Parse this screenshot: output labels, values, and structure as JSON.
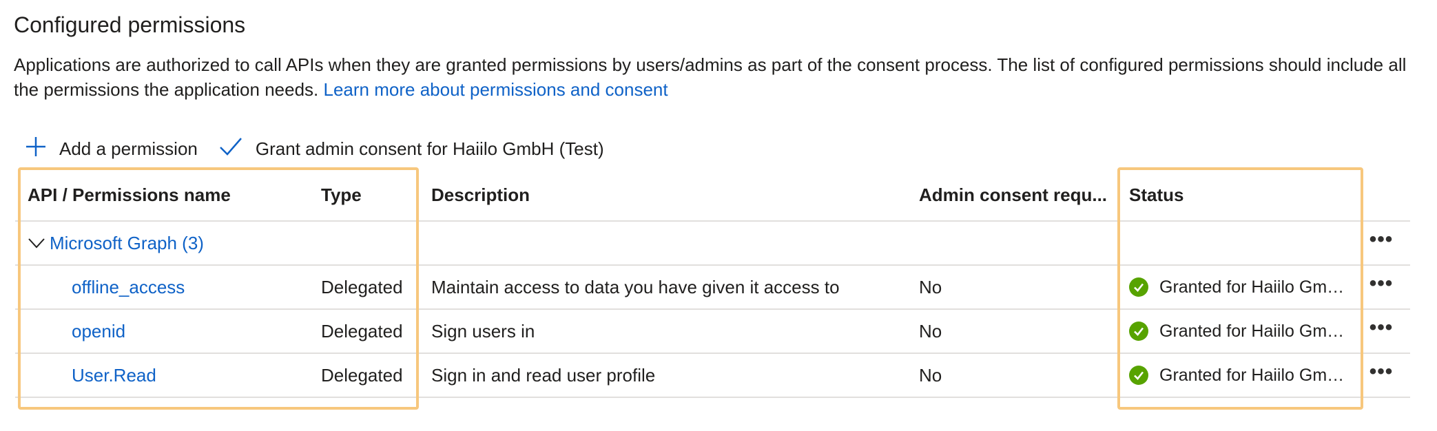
{
  "page": {
    "title": "Configured permissions",
    "intro_text": "Applications are authorized to call APIs when they are granted permissions by users/admins as part of the consent process. The list of configured permissions should include all the permissions the application needs.",
    "intro_link": "Learn more about permissions and consent"
  },
  "toolbar": {
    "add_label": "Add a permission",
    "grant_label": "Grant admin consent for Haiilo GmbH (Test)"
  },
  "table": {
    "headers": {
      "api": "API / Permissions name",
      "type": "Type",
      "description": "Description",
      "admin": "Admin consent requ...",
      "status": "Status"
    },
    "group": {
      "label": "Microsoft Graph (3)",
      "more": "•••"
    },
    "rows": [
      {
        "name": "offline_access",
        "type": "Delegated",
        "description": "Maintain access to data you have given it access to",
        "admin": "No",
        "status": "Granted for Haiilo GmbH (Test)",
        "more": "•••"
      },
      {
        "name": "openid",
        "type": "Delegated",
        "description": "Sign users in",
        "admin": "No",
        "status": "Granted for Haiilo GmbH (Test)",
        "more": "•••"
      },
      {
        "name": "User.Read",
        "type": "Delegated",
        "description": "Sign in and read user profile",
        "admin": "No",
        "status": "Granted for Haiilo GmbH (Test)",
        "more": "•••"
      }
    ]
  },
  "colors": {
    "link": "#0f62c7",
    "status_success": "#57a300",
    "highlight": "#f7c77d",
    "divider": "#e1dfdd"
  },
  "icons": {
    "add": "plus-icon",
    "grant": "checkmark-icon",
    "expand": "chevron-down-icon",
    "status": "success-check-icon",
    "more": "more-options-icon"
  }
}
